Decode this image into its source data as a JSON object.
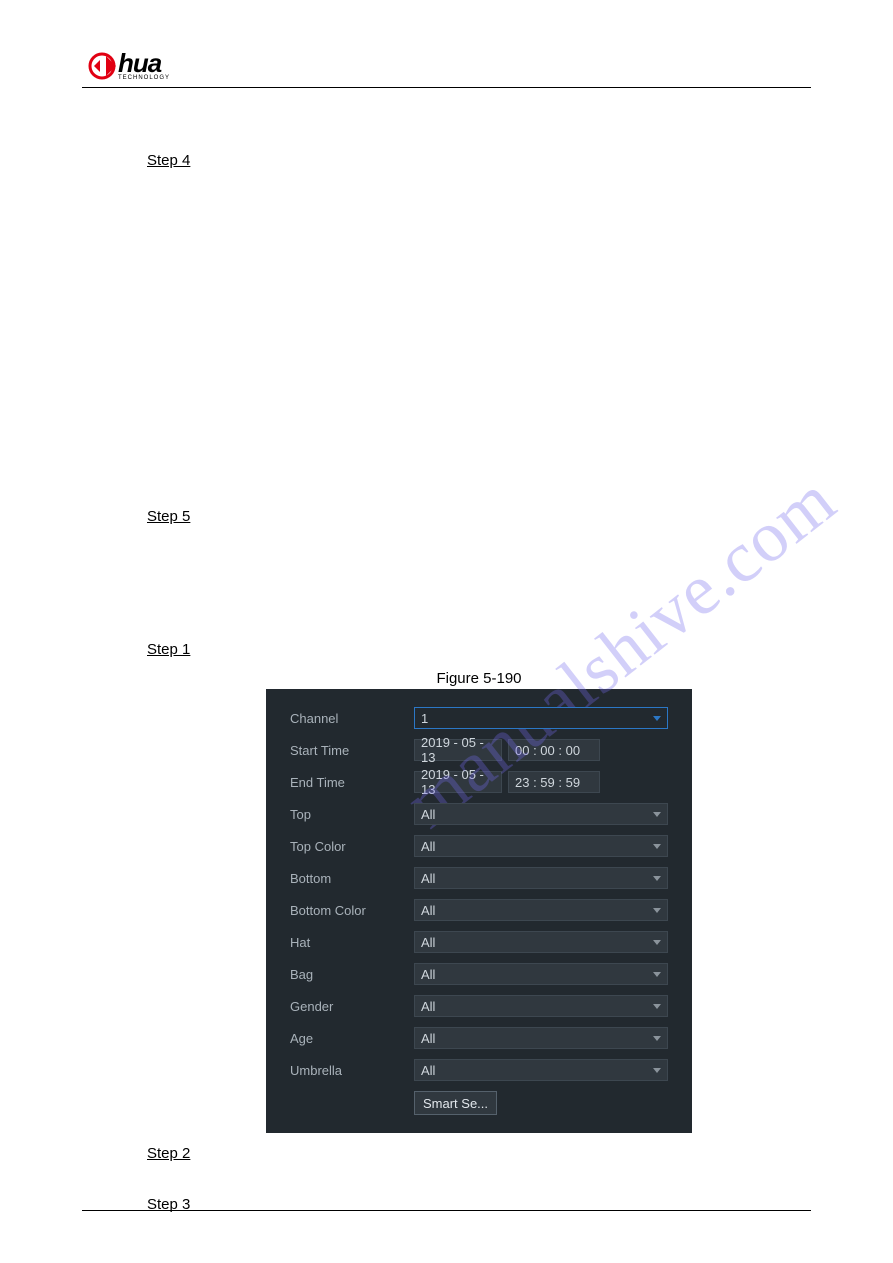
{
  "logo": {
    "text": "hua",
    "sub": "TECHNOLOGY"
  },
  "watermark": "manualshive.com",
  "steps": {
    "s4": "Step 4",
    "s5": "Step 5",
    "s1": "Step 1",
    "s2": "Step 2",
    "s3": "Step 3"
  },
  "figure": {
    "label": "Figure 5-190"
  },
  "panel": {
    "channel": {
      "label": "Channel",
      "value": "1"
    },
    "start": {
      "label": "Start Time",
      "date": "2019 - 05 - 13",
      "time": "00 : 00 : 00"
    },
    "end": {
      "label": "End Time",
      "date": "2019 - 05 - 13",
      "time": "23 : 59 : 59"
    },
    "top": {
      "label": "Top",
      "value": "All"
    },
    "topcolor": {
      "label": "Top Color",
      "value": "All"
    },
    "bottom": {
      "label": "Bottom",
      "value": "All"
    },
    "bottomcolor": {
      "label": "Bottom Color",
      "value": "All"
    },
    "hat": {
      "label": "Hat",
      "value": "All"
    },
    "bag": {
      "label": "Bag",
      "value": "All"
    },
    "gender": {
      "label": "Gender",
      "value": "All"
    },
    "age": {
      "label": "Age",
      "value": "All"
    },
    "umbrella": {
      "label": "Umbrella",
      "value": "All"
    },
    "button": "Smart Se..."
  }
}
